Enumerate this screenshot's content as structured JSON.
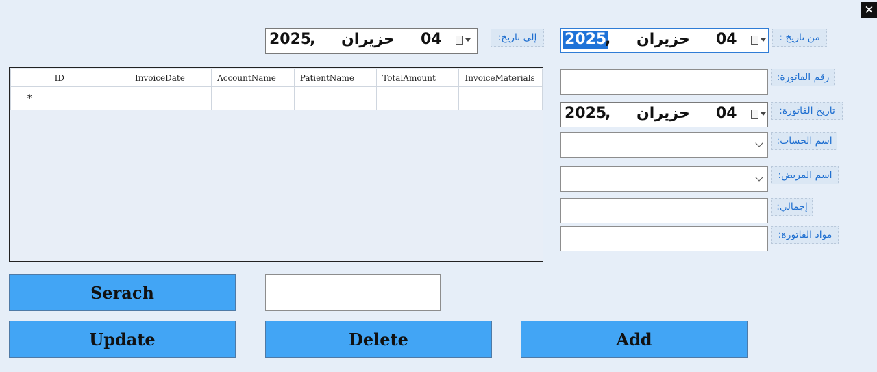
{
  "window": {
    "close_glyph": "✕"
  },
  "filter": {
    "from_label": "من تاريخ :",
    "to_label": "إلى تاريخ:",
    "from_date": {
      "year": "2025",
      "comma": ",",
      "month": "حزيران",
      "day": "04"
    },
    "to_date": {
      "year": "2025",
      "comma": ",",
      "month": "حزيران",
      "day": "04"
    }
  },
  "form": {
    "invoice_number_label": "رقم الفاتورة:",
    "invoice_number_value": "",
    "invoice_date_label": "تاريخ الفاتورة:",
    "invoice_date": {
      "year": "2025",
      "comma": ",",
      "month": "حزيران",
      "day": "04"
    },
    "account_name_label": "اسم الحساب:",
    "account_name_value": "",
    "patient_name_label": "اسم المريض:",
    "patient_name_value": "",
    "total_label": "إجمالي:",
    "total_value": "",
    "materials_label": "مواد الفاتورة:",
    "materials_value": ""
  },
  "grid": {
    "columns": [
      "ID",
      "InvoiceDate",
      "AccountName",
      "PatientName",
      "TotalAmount",
      "InvoiceMaterials"
    ],
    "new_row_marker": "*"
  },
  "search": {
    "input_value": ""
  },
  "buttons": {
    "search": "Serach",
    "update": "Update",
    "delete": "Delete",
    "add": "Add"
  },
  "colors": {
    "background": "#e6eef8",
    "button": "#42a5f5",
    "label_text": "#1f6fd0",
    "selection": "#1f73d8"
  }
}
